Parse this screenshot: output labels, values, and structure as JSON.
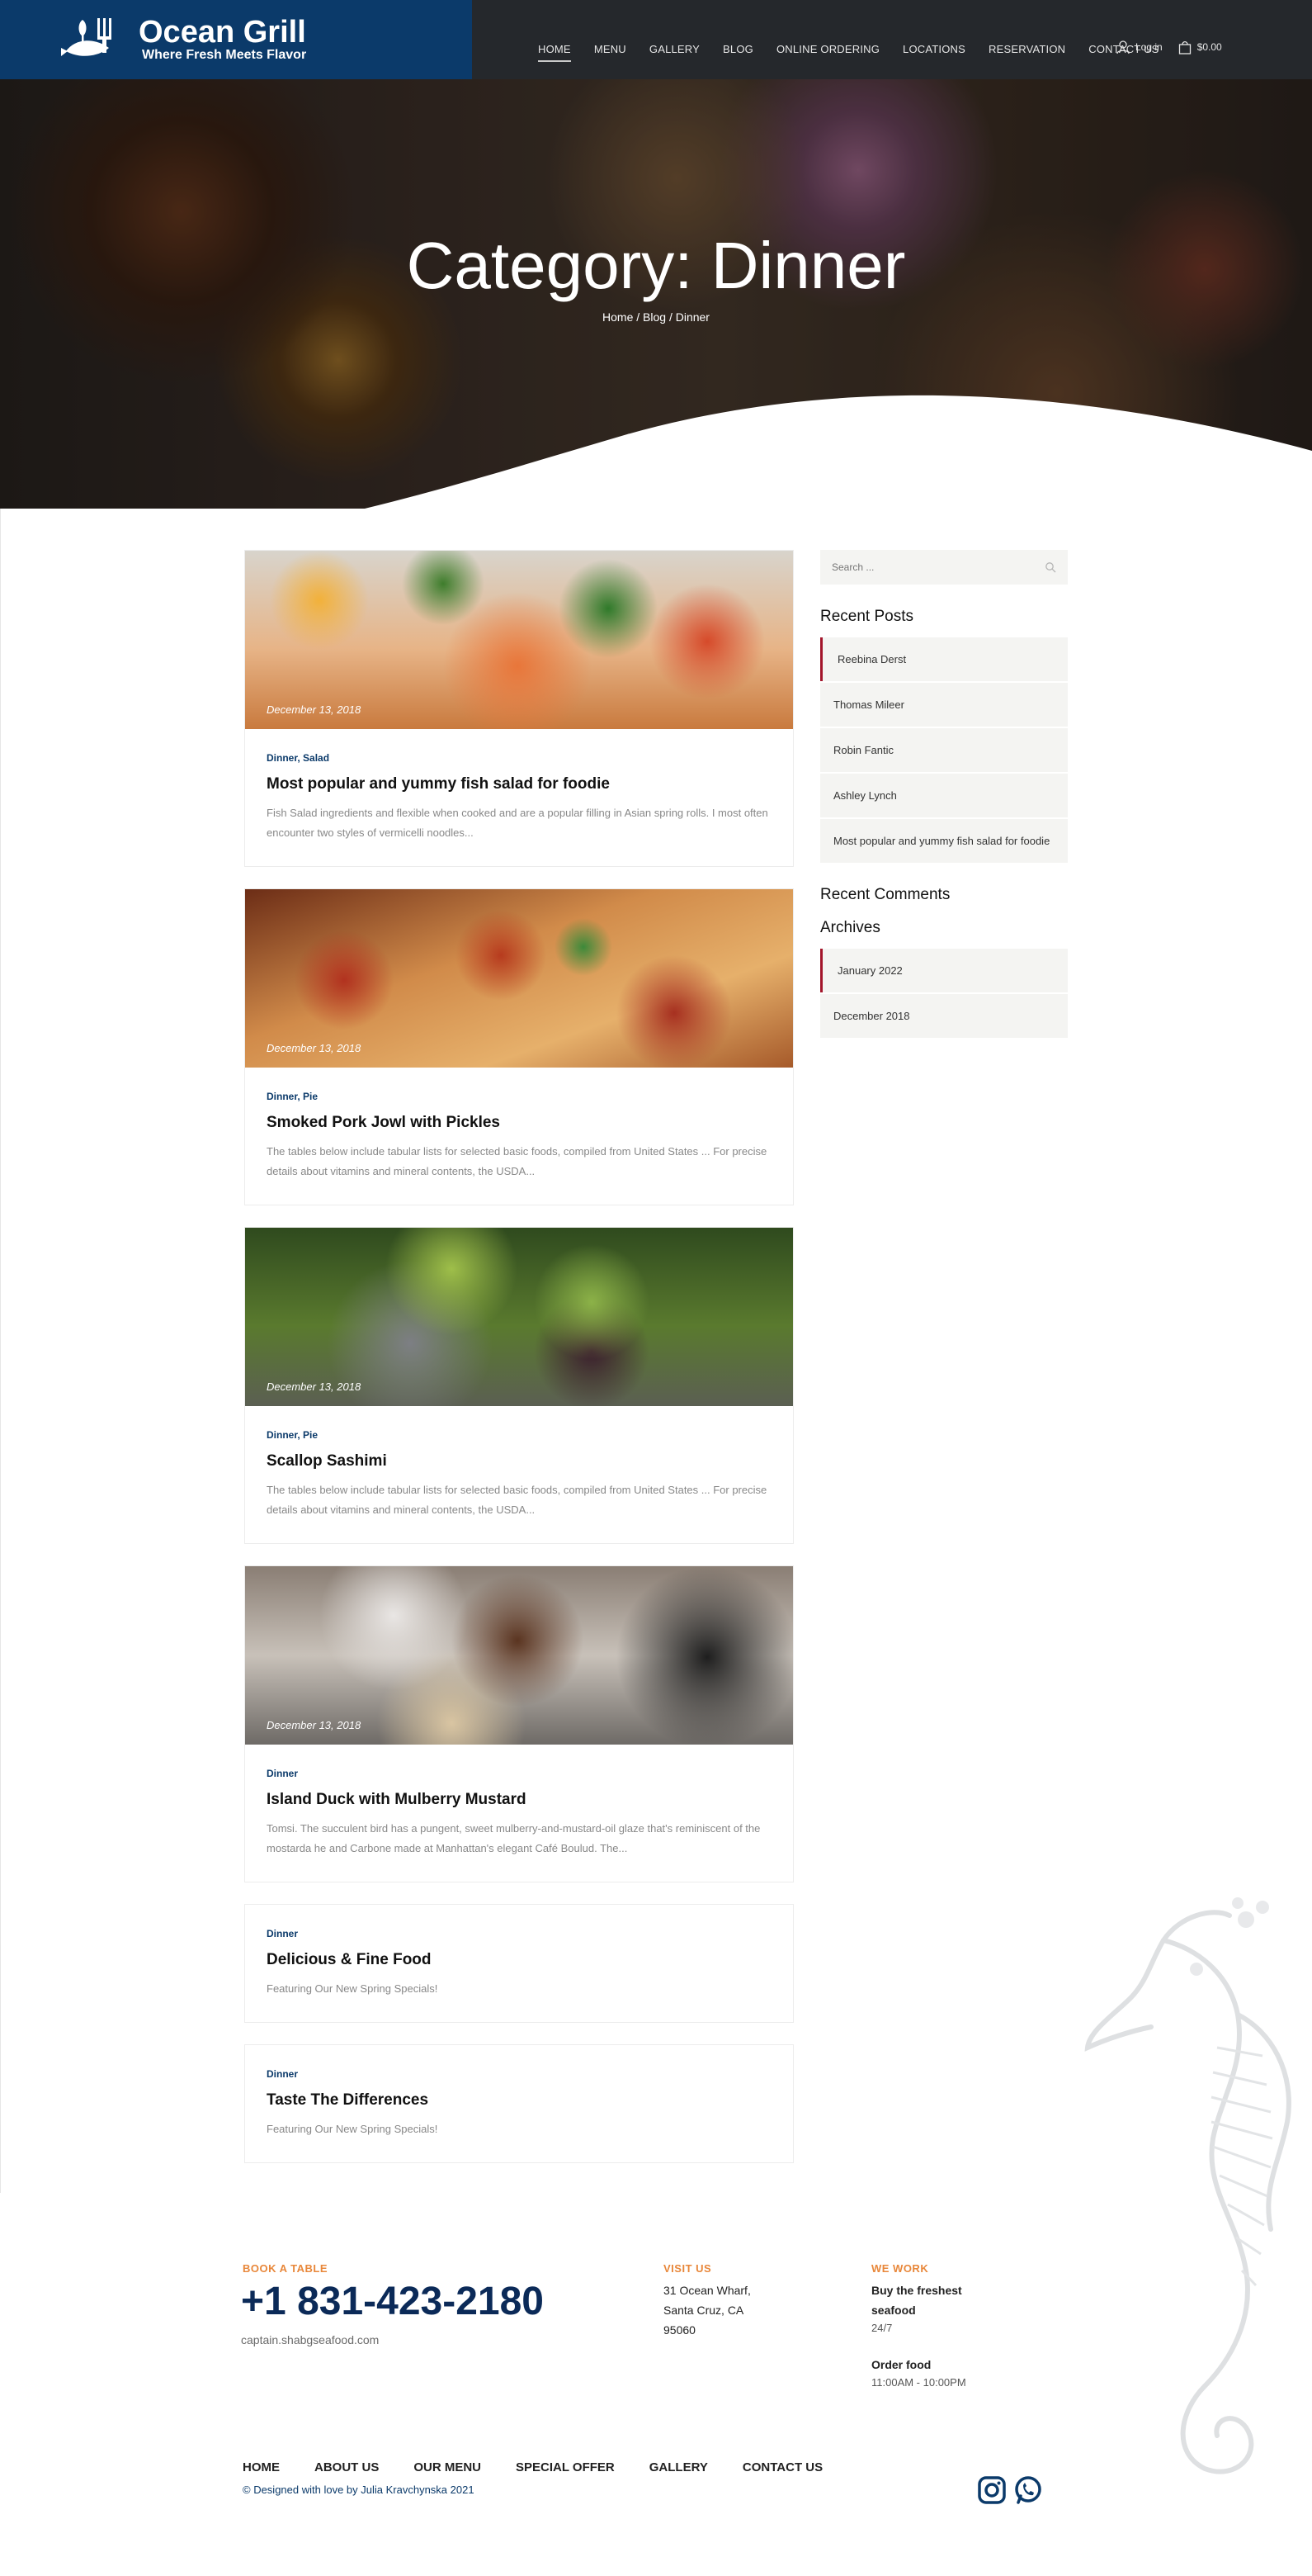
{
  "brand": {
    "name": "Ocean Grill",
    "tagline": "Where Fresh Meets Flavor"
  },
  "nav": {
    "items": [
      "HOME",
      "MENU",
      "GALLERY",
      "BLOG",
      "ONLINE ORDERING",
      "LOCATIONS",
      "RESERVATION",
      "CONTACT US"
    ],
    "active": "HOME",
    "login_label": "Log in",
    "cart_total": "$0.00"
  },
  "hero": {
    "title": "Category: Dinner",
    "breadcrumb": "Home / Blog / Dinner"
  },
  "posts": [
    {
      "date": "December 13, 2018",
      "categories": "Dinner, Salad",
      "title": "Most popular and yummy fish salad for foodie",
      "excerpt": "Fish Salad ingredients and flexible when cooked and are a popular filling in Asian spring rolls. I most often encounter two styles of vermicelli noodles...",
      "image": "salad"
    },
    {
      "date": "December 13, 2018",
      "categories": "Dinner, Pie",
      "title": "Smoked Pork Jowl with Pickles",
      "excerpt": "The tables below include tabular lists for selected basic foods, compiled from United States ... For precise details about vitamins and mineral contents, the USDA...",
      "image": "pizza"
    },
    {
      "date": "December 13, 2018",
      "categories": "Dinner, Pie",
      "title": "Scallop Sashimi",
      "excerpt": "The tables below include tabular lists for selected basic foods, compiled from United States ... For precise details about vitamins and mineral contents, the USDA...",
      "image": "grapes"
    },
    {
      "date": "December 13, 2018",
      "categories": "Dinner",
      "title": "Island Duck with Mulberry Mustard",
      "excerpt": "Tomsi. The succulent bird has a pungent, sweet mulberry-and-mustard-oil glaze that's reminiscent of the mostarda he and Carbone made at Manhattan's elegant Café Boulud. The...",
      "image": "duck"
    },
    {
      "date": "",
      "categories": "Dinner",
      "title": "Delicious & Fine Food",
      "excerpt": "Featuring Our New Spring Specials!",
      "image": ""
    },
    {
      "date": "",
      "categories": "Dinner",
      "title": "Taste The Differences",
      "excerpt": "Featuring Our New Spring Specials!",
      "image": ""
    }
  ],
  "sidebar": {
    "search_placeholder": "Search ...",
    "recent_posts_title": "Recent Posts",
    "recent_posts": [
      "Reebina Derst",
      "Thomas Mileer",
      "Robin Fantic",
      "Ashley Lynch",
      "Most popular and yummy fish salad for foodie"
    ],
    "recent_comments_title": "Recent Comments",
    "archives_title": "Archives",
    "archives": [
      "January 2022",
      "December 2018"
    ]
  },
  "footer": {
    "book_label": "BOOK A TABLE",
    "phone": "+1 831-423-2180",
    "email": "captain.shabgseafood.com",
    "visit_label": "VISIT US",
    "address": [
      "31 Ocean Wharf,",
      "Santa Cruz, CA",
      "95060"
    ],
    "work_label": "WE WORK",
    "work_lines": [
      "Buy the freshest",
      "seafood"
    ],
    "work_hours_1": "24/7",
    "order_title": "Order food",
    "order_hours": "11:00AM - 10:00PM",
    "nav": [
      "HOME",
      "ABOUT US",
      "OUR MENU",
      "SPECIAL OFFER",
      "GALLERY",
      "CONTACT US"
    ],
    "credit": "© Designed with love by Julia Kravchynska 2021",
    "socials": [
      "instagram-icon",
      "whatsapp-icon"
    ]
  },
  "colors": {
    "brand_navy": "#0b3a6a",
    "nav_dark": "#25282c",
    "accent_red": "#a3152b",
    "footer_orange": "#e8873a"
  }
}
